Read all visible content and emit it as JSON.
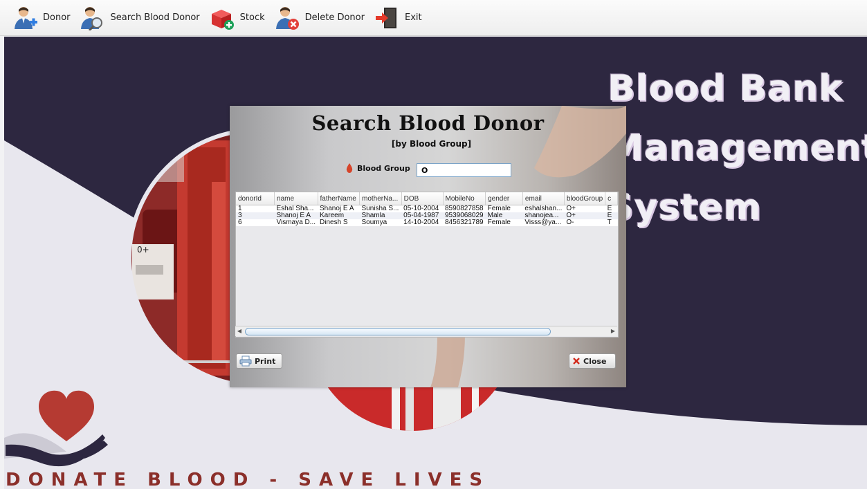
{
  "menubar": {
    "items": [
      {
        "label": "Donor",
        "icon": "donor-add-icon"
      },
      {
        "label": "Search Blood Donor",
        "icon": "donor-search-icon"
      },
      {
        "label": "Stock",
        "icon": "stock-add-icon"
      },
      {
        "label": "Delete Donor",
        "icon": "donor-delete-icon"
      },
      {
        "label": "Exit",
        "icon": "exit-door-icon"
      }
    ]
  },
  "background": {
    "title_lines": [
      "Blood Bank",
      "Management",
      "System"
    ],
    "tagline": "DONATE BLOOD - SAVE LIVES",
    "colors": {
      "dark": "#2d2740",
      "light": "#e8e7ee",
      "heart": "#b53a32"
    }
  },
  "dialog": {
    "title": "Search Blood Donor",
    "subtitle": "[by Blood Group]",
    "field_label": "Blood Group",
    "field_value": "O",
    "columns": [
      "donorId",
      "name",
      "fatherName",
      "motherNa...",
      "DOB",
      "MobileNo",
      "gender",
      "email",
      "bloodGroup",
      "c"
    ],
    "rows": [
      [
        "1",
        "Eshal Sha...",
        "Shanoj E A",
        "Sunisha S...",
        "05-10-2004",
        "8590827858",
        "Female",
        "eshalshan...",
        "O+",
        "E"
      ],
      [
        "3",
        "Shanoj E A",
        "Kareem",
        "Shamla",
        "05-04-1987",
        "9539068029",
        "Male",
        "shanojea...",
        "O+",
        "E"
      ],
      [
        "6",
        "Vismaya D...",
        "Dinesh S",
        "Soumya",
        "14-10-2004",
        "8456321789",
        "Female",
        "Visss@ya...",
        "O-",
        "T"
      ]
    ],
    "print_label": "Print",
    "close_label": "Close"
  }
}
